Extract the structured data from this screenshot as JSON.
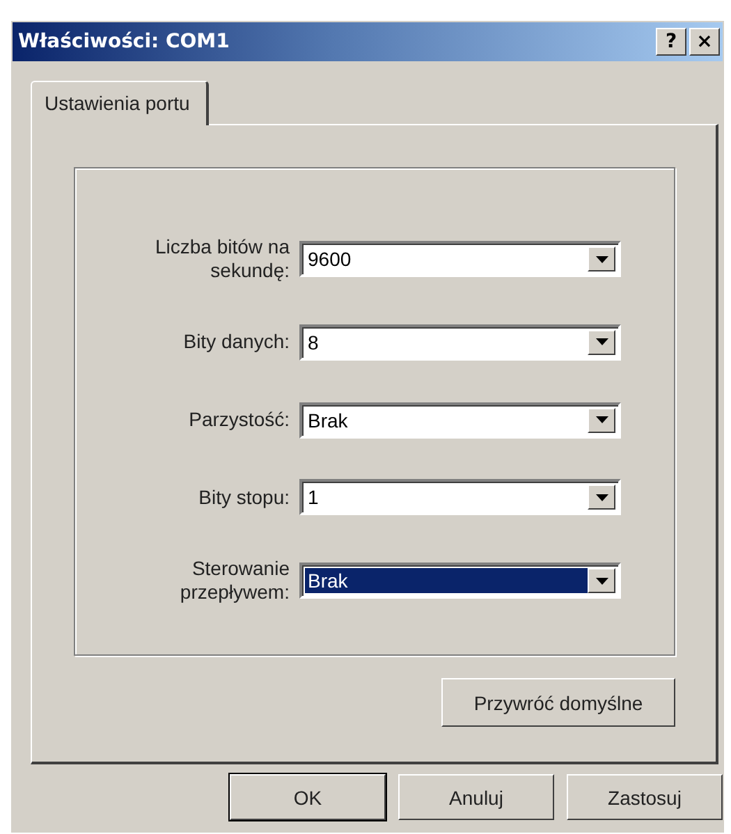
{
  "window": {
    "title": "Właściwości: COM1",
    "title_buttons": [
      "?",
      "×"
    ]
  },
  "tabs": [
    {
      "label": "Ustawienia portu",
      "selected": true
    }
  ],
  "fields": [
    {
      "label": "Liczba bitów na sekundę:",
      "value": "9600",
      "highlighted": false
    },
    {
      "label": "Bity danych:",
      "value": "8",
      "highlighted": false
    },
    {
      "label": "Parzystość:",
      "value": "Brak",
      "highlighted": false
    },
    {
      "label": "Bity stopu:",
      "value": "1",
      "highlighted": false
    },
    {
      "label": "Sterowanie przepływem:",
      "value": "Brak",
      "highlighted": true
    }
  ],
  "restore_button": "Przywróć domyślne",
  "buttons": [
    {
      "label": "OK",
      "default": true
    },
    {
      "label": "Anuluj",
      "default": false
    },
    {
      "label": "Zastosuj",
      "default": false
    }
  ]
}
